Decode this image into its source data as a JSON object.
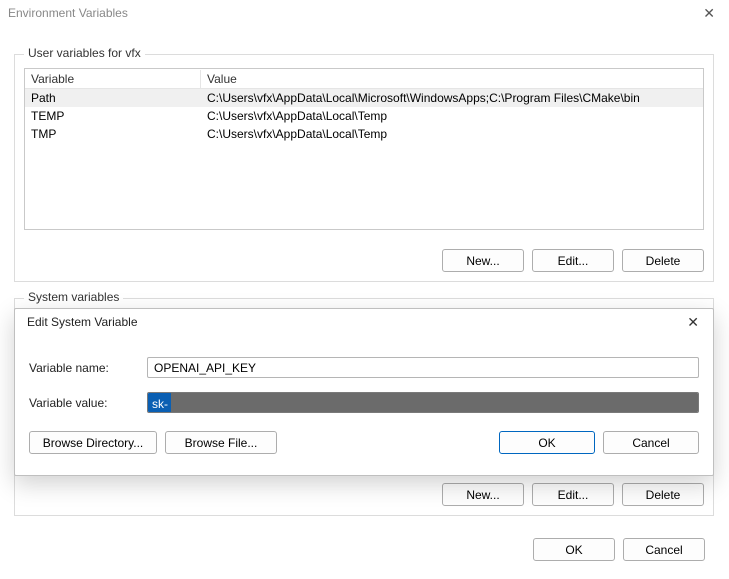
{
  "window": {
    "title": "Environment Variables"
  },
  "user_group": {
    "label": "User variables for vfx",
    "headers": {
      "variable": "Variable",
      "value": "Value"
    },
    "rows": [
      {
        "variable": "Path",
        "value": "C:\\Users\\vfx\\AppData\\Local\\Microsoft\\WindowsApps;C:\\Program Files\\CMake\\bin"
      },
      {
        "variable": "TEMP",
        "value": "C:\\Users\\vfx\\AppData\\Local\\Temp"
      },
      {
        "variable": "TMP",
        "value": "C:\\Users\\vfx\\AppData\\Local\\Temp"
      }
    ],
    "buttons": {
      "new": "New...",
      "edit": "Edit...",
      "delete": "Delete"
    }
  },
  "sys_group": {
    "label": "System variables",
    "buttons": {
      "new": "New...",
      "edit": "Edit...",
      "delete": "Delete"
    }
  },
  "main_buttons": {
    "ok": "OK",
    "cancel": "Cancel"
  },
  "modal": {
    "title": "Edit System Variable",
    "labels": {
      "name": "Variable name:",
      "value": "Variable value:"
    },
    "name_value": "OPENAI_API_KEY",
    "value_prefix": "sk-",
    "buttons": {
      "browse_dir": "Browse Directory...",
      "browse_file": "Browse File...",
      "ok": "OK",
      "cancel": "Cancel"
    }
  }
}
